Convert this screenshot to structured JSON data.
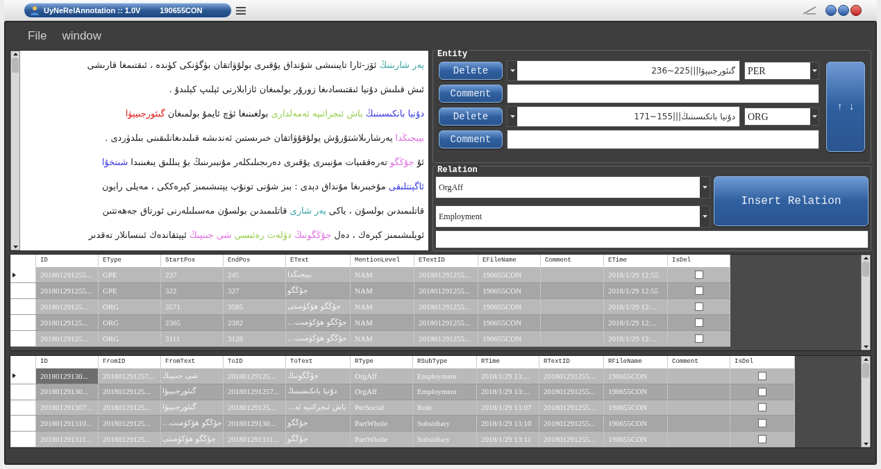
{
  "title_bar": {
    "app": "UyNeRelAnnotation :: 1.0V",
    "file": "190655CON"
  },
  "menu": [
    "File",
    "window"
  ],
  "document": {
    "lines": [
      [
        {
          "text": "يەر شارىنىڭ",
          "color": "#3aa6a6"
        },
        {
          "text": "ئۆز-ئارا تايىنىشى شۇنداق يۇقىرى بولۇۋاتقان بۈگۈنكى كۈندە ، ئىقتىمغا قارىشى",
          "color": "#222222"
        }
      ],
      [
        {
          "text": "ئىش قىلىش دۇنيا ئىقتىسادىغا زورۇر بولمىغان ئازابلارنى ئېلىپ كېلىدۇ .",
          "color": "#222222"
        }
      ],
      [
        {
          "text": "دۇنيا بانكىسىنىڭ",
          "color": "#3a3ae0"
        },
        {
          "text": "باش ئىجرائىيە ئەمەلدارى",
          "color": "#9acd50"
        },
        {
          "text": "بولغىنىغا ئۈچ ئايمۇ بولمىغان",
          "color": "#222222"
        },
        {
          "text": "گىئورجىيېۋا",
          "color": "#e02020"
        }
      ],
      [
        {
          "text": "بېيجىڭدا",
          "color": "#e070e0"
        },
        {
          "text": "يەرشارىلاشتۇرۇش يولۇقۇۋاتقان خىرىستىن ئەندىشە قىلىدىغانلىقىنى بىلدۈردى .",
          "color": "#222222"
        }
      ],
      [
        {
          "text": "ئۇ",
          "color": "#222222"
        },
        {
          "text": "جۇڭگو",
          "color": "#e070e0"
        },
        {
          "text": "تەرەققىيات مۇنبىرى يۇقىرى دەرىجىلىكلەر مۇنبىرىنىڭ بۇ يىللىق يىغىنىدا",
          "color": "#222222"
        },
        {
          "text": "شىنخۇا",
          "color": "#3a3ae0"
        }
      ],
      [
        {
          "text": "ئاگېنتلىقى",
          "color": "#3a3ae0"
        },
        {
          "text": "مۇخبىرىغا مۇنداق دېدى : بىز شۇنى تونۇپ يېتىشىمىز كېرەككى ، مەيلى رايون",
          "color": "#222222"
        }
      ],
      [
        {
          "text": "قاتلىمىدىن بولسۇن ، ياكى",
          "color": "#222222"
        },
        {
          "text": "يەر شارى",
          "color": "#3aa6a6"
        },
        {
          "text": "قاتلىمىدىن بولسۇن مەسىلىلەرنى ئورتاق جەھەتتىن",
          "color": "#222222"
        }
      ],
      [
        {
          "text": "ئويلىشىمىز كېرەك ، دەل",
          "color": "#222222"
        },
        {
          "text": "جۇڭگونىڭ",
          "color": "#e070e0"
        },
        {
          "text": "دۆلەت رەئىسى",
          "color": "#9acd50"
        },
        {
          "text": "شى جىنپىڭ",
          "color": "#e070e0"
        },
        {
          "text": "ئېيتقاندەك ئىنسانلار تەقدىر",
          "color": "#222222"
        }
      ]
    ]
  },
  "entity": {
    "label": "Entity",
    "swap_label": "↑ ↓",
    "items": [
      {
        "delete_label": "Delete",
        "mention": "گىئورجىيېۋا|||225~236",
        "type": "PER",
        "comment_label": "Comment"
      },
      {
        "delete_label": "Delete",
        "mention": "دۇنيا بانكىسىنىڭ|||155~171",
        "type": "ORG",
        "comment_label": "Comment"
      }
    ]
  },
  "relation": {
    "label": "Relation",
    "type": "OrgAff",
    "subtype": "Employment",
    "insert_label": "Insert Relation"
  },
  "entity_table": {
    "columns": [
      "ID",
      "EType",
      "StartPos",
      "EndPos",
      "EText",
      "MentionLevel",
      "ETextID",
      "EFileName",
      "Comment",
      "ETime",
      "IsDel"
    ],
    "rows": [
      {
        "selected": true,
        "cells": [
          "201801291255...",
          "GPE",
          "237",
          "245",
          "بېيجىڭدا",
          "NAM",
          "201801291255...",
          "190655CON",
          "",
          "2018/1/29 12:55"
        ],
        "is_del": false
      },
      {
        "selected": false,
        "cells": [
          "201801291255...",
          "GPE",
          "322",
          "327",
          "جۇڭگو",
          "NAM",
          "201801291255...",
          "190655CON",
          "",
          "2018/1/29 12:55"
        ],
        "is_del": false
      },
      {
        "selected": false,
        "cells": [
          "20180129125...",
          "ORG",
          "3571",
          "3585",
          "جۇڭگو ھۆكۈمىتى",
          "NAM",
          "201801291255...",
          "190655CON",
          "",
          "2018/1/29 12:..."
        ],
        "is_del": false
      },
      {
        "selected": false,
        "cells": [
          "20180129125...",
          "ORG",
          "2365",
          "2382",
          "...جۇڭگو ھۆكۈمىت",
          "NAM",
          "201801291255...",
          "190655CON",
          "",
          "2018/1/29 12:..."
        ],
        "is_del": false
      },
      {
        "selected": false,
        "cells": [
          "20180129125...",
          "ORG",
          "3111",
          "3128",
          "...جۇڭگو ھۆكۈمىت",
          "NAM",
          "201801291255...",
          "190655CON",
          "",
          "2018/1/29 12:..."
        ],
        "is_del": false
      }
    ]
  },
  "relation_table": {
    "columns": [
      "ID",
      "FromID",
      "FromText",
      "ToID",
      "ToText",
      "RType",
      "RSubType",
      "RTime",
      "RTextID",
      "RFileName",
      "Comment",
      "IsDel"
    ],
    "rows": [
      {
        "selected": true,
        "cells": [
          "20180129130...",
          "201801291257...",
          "شى جىنپىڭ",
          "20180129125...",
          "جۇڭگونىڭ",
          "OrgAff",
          "Employment",
          "2018/1/29 13:...",
          "201801291255...",
          "190655CON",
          ""
        ],
        "is_del": false
      },
      {
        "selected": false,
        "cells": [
          "20180129130...",
          "20180129125...",
          "گىئورجىيېۋا",
          "201801291257...",
          "دۇنيا بانكىسىنىڭ",
          "OrgAff",
          "Employment",
          "2018/1/29 13:...",
          "201801291255...",
          "190655CON",
          ""
        ],
        "is_del": false
      },
      {
        "selected": false,
        "cells": [
          "201801291307...",
          "20180129125...",
          "گىئورجىيېۋا",
          "20180129125...",
          "...باش ئىجرائىيە ئە",
          "PerSocial",
          "Role",
          "2018/1/29 13:07",
          "201801291255...",
          "190655CON",
          ""
        ],
        "is_del": false
      },
      {
        "selected": false,
        "cells": [
          "201801291310...",
          "20180129125...",
          "...جۇڭگو ھۆكۈمىت",
          "20180129130...",
          "جۇڭگو",
          "PartWhole",
          "Subsidiary",
          "2018/1/29 13:10",
          "201801291255...",
          "190655CON",
          ""
        ],
        "is_del": false
      },
      {
        "selected": false,
        "cells": [
          "201801291311...",
          "20180129125...",
          "جۇڭگو ھۆكۈمىتى",
          "201801291311...",
          "جۇڭگو",
          "PartWhole",
          "Subsidiary",
          "2018/1/29 13:11",
          "201801291255...",
          "190655CON",
          ""
        ],
        "is_del": false
      }
    ]
  }
}
